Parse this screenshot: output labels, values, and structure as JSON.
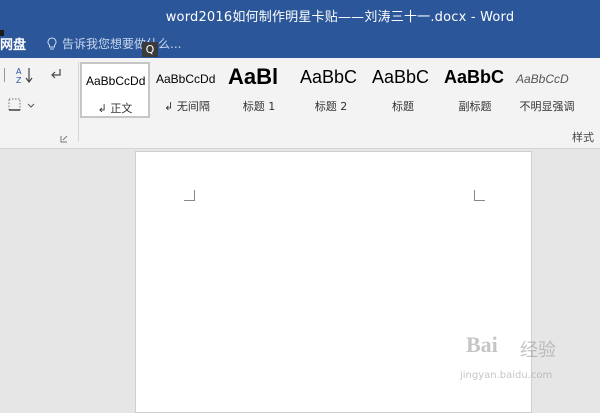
{
  "window": {
    "title": "word2016如何制作明星卡贴——刘涛三十一.docx - Word"
  },
  "ribbon_tabs": {
    "partial_tab": "网盘"
  },
  "tell_me": {
    "placeholder": "告诉我您想要做什么..."
  },
  "keytip": {
    "label": "Q"
  },
  "paragraph_group": {
    "sort_icon": "sort-az-icon",
    "show_marks_icon": "pilcrow-icon",
    "borders_icon": "borders-icon"
  },
  "styles": {
    "group_label": "样式",
    "items": [
      {
        "sample": "AaBbCcDd",
        "label": "↲ 正文"
      },
      {
        "sample": "AaBbCcDd",
        "label": "↲ 无间隔"
      },
      {
        "sample": "AaBl",
        "label": "标题 1"
      },
      {
        "sample": "AaBbC",
        "label": "标题 2"
      },
      {
        "sample": "AaBbC",
        "label": "标题"
      },
      {
        "sample": "AaBbC",
        "label": "副标题"
      },
      {
        "sample": "AaBbCcD",
        "label": "不明显强调"
      }
    ]
  },
  "watermark": {
    "brand": "Bai",
    "text": "经验",
    "url": "jingyan.baidu.com"
  },
  "colors": {
    "accent": "#2b579a",
    "ribbon_bg": "#f3f3f3",
    "canvas_bg": "#e6e6e6"
  }
}
